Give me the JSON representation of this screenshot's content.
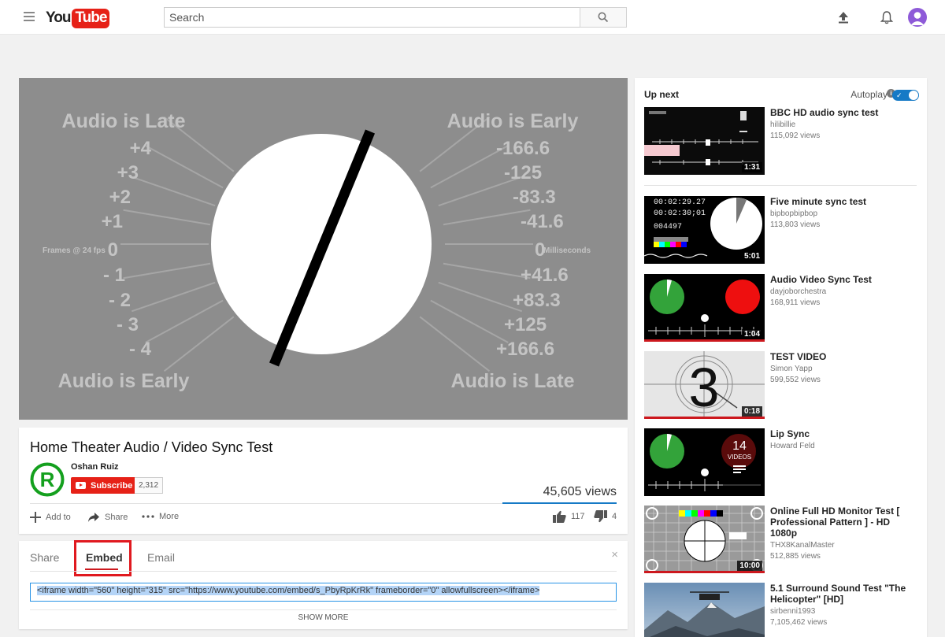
{
  "header": {
    "logo_you": "You",
    "logo_tube": "Tube",
    "search_placeholder": "Search"
  },
  "player": {
    "left_top": "Audio is Late",
    "left_bottom": "Audio is Early",
    "right_top": "Audio is Early",
    "right_bottom": "Audio is Late",
    "left_axis": "Frames @ 24 fps",
    "right_axis": "Milliseconds",
    "frames": [
      "+4",
      "+3",
      "+2",
      "+1",
      "0",
      "- 1",
      "- 2",
      "- 3",
      "- 4"
    ],
    "ms": [
      "-166.6",
      "-125",
      "-83.3",
      "-41.6",
      "0",
      "+41.6",
      "+83.3",
      "+125",
      "+166.6"
    ]
  },
  "video": {
    "title": "Home Theater Audio / Video Sync Test",
    "channel": "Oshan Ruiz",
    "subscribe_label": "Subscribe",
    "subscriber_count": "2,312",
    "views": "45,605 views",
    "add_to": "Add to",
    "share": "Share",
    "more": "More",
    "likes": "117",
    "dislikes": "4"
  },
  "share_panel": {
    "tabs": [
      "Share",
      "Embed",
      "Email"
    ],
    "active_tab": "Embed",
    "close": "×",
    "embed_code": "<iframe width=\"560\" height=\"315\" src=\"https://www.youtube.com/embed/s_PbyRpKrRk\" frameborder=\"0\" allowfullscreen></iframe>",
    "show_more": "SHOW MORE"
  },
  "sidebar": {
    "up_next": "Up next",
    "autoplay": "Autoplay",
    "items": [
      {
        "title": "BBC HD audio sync test",
        "channel": "hilibillie",
        "views": "115,092 views",
        "duration": "1:31"
      },
      {
        "title": "Five minute sync test",
        "channel": "bipbopbipbop",
        "views": "113,803 views",
        "duration": "5:01",
        "timecodes": [
          "00:02:29.27",
          "00:02:30;01",
          "004497"
        ]
      },
      {
        "title": "Audio Video Sync Test",
        "channel": "dayjoborchestra",
        "views": "168,911 views",
        "duration": "1:04"
      },
      {
        "title": "TEST VIDEO",
        "channel": "Simon Yapp",
        "views": "599,552 views",
        "duration": "0:18",
        "countdown": "3"
      },
      {
        "title": "Lip Sync",
        "channel": "Howard Feld",
        "playlist_count": "14",
        "playlist_label": "VIDEOS"
      },
      {
        "title": "Online Full HD Monitor Test [ Professional Pattern ] - HD 1080p",
        "channel": "THX8KanalMaster",
        "views": "512,885 views",
        "duration": "10:00"
      },
      {
        "title": "5.1 Surround Sound Test \"The Helicopter\" [HD]",
        "channel": "sirbenni1993",
        "views": "7,105,462 views"
      }
    ]
  }
}
